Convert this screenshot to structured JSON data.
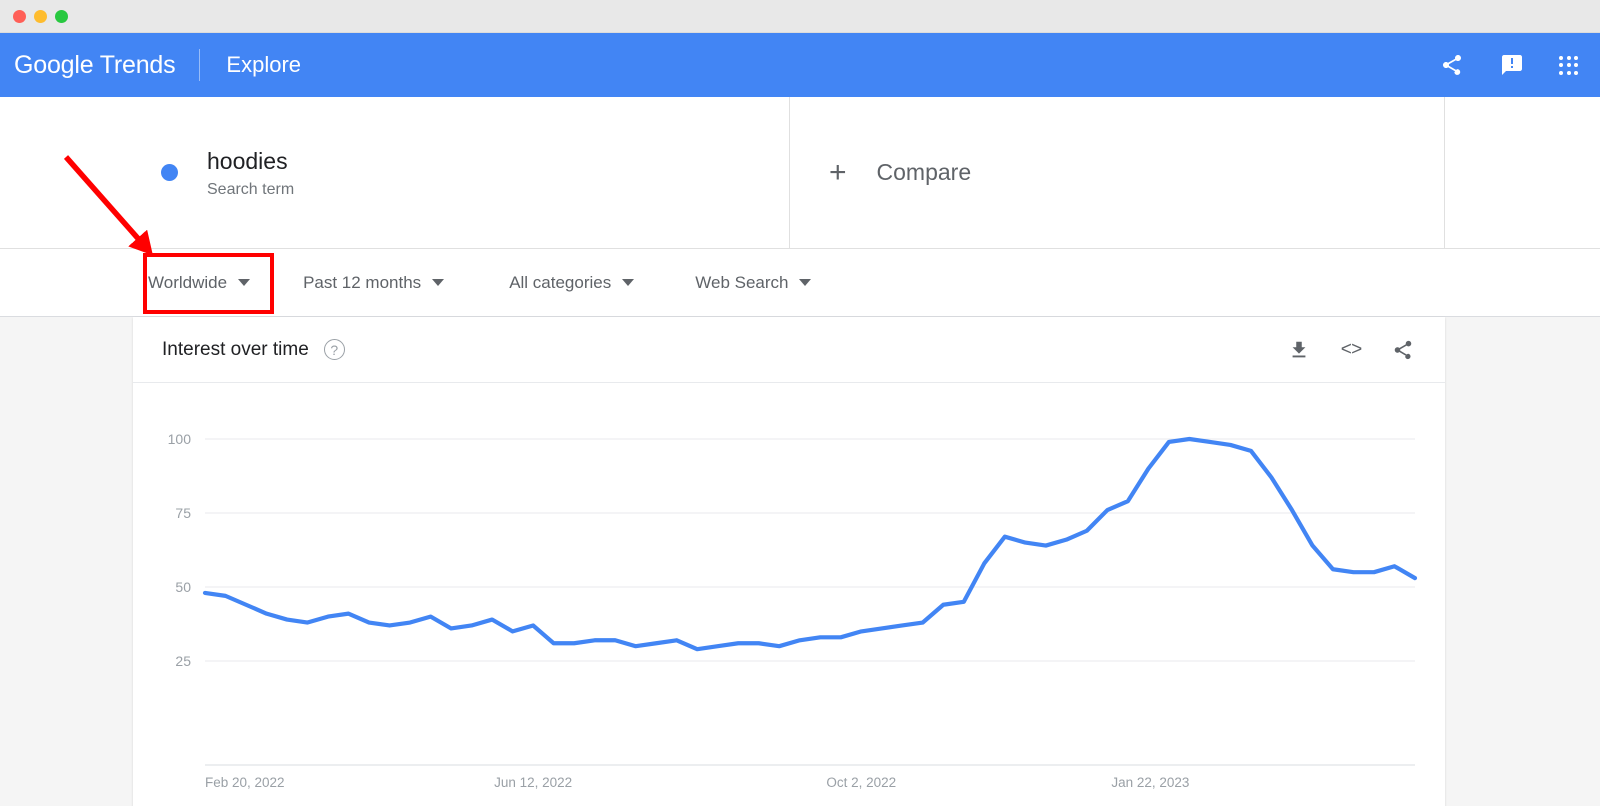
{
  "window": {
    "traffic_lights": [
      "close",
      "minimize",
      "maximize"
    ]
  },
  "header": {
    "brand_google": "Google",
    "brand_trends": "Trends",
    "nav_explore": "Explore",
    "icons": [
      "share-icon",
      "feedback-icon",
      "apps-grid-icon"
    ],
    "background_color": "#4285f4"
  },
  "search_terms": {
    "items": [
      {
        "name": "hoodies",
        "type": "Search term",
        "color": "#4285f4"
      }
    ],
    "compare_label": "Compare",
    "compare_plus": "+"
  },
  "filters": [
    {
      "name": "location",
      "value": "Worldwide",
      "highlighted": true
    },
    {
      "name": "time-range",
      "value": "Past 12 months",
      "highlighted": false
    },
    {
      "name": "category",
      "value": "All categories",
      "highlighted": false
    },
    {
      "name": "search-type",
      "value": "Web Search",
      "highlighted": false
    }
  ],
  "annotation": {
    "color": "#ff0000",
    "target": "Worldwide",
    "type": "arrow-and-box"
  },
  "card": {
    "title": "Interest over time",
    "help_glyph": "?",
    "actions": [
      {
        "name": "download-csv",
        "icon": "download-icon"
      },
      {
        "name": "embed",
        "icon": "embed-code-icon",
        "glyph": "<>"
      },
      {
        "name": "share",
        "icon": "share-icon"
      }
    ]
  },
  "chart_data": {
    "type": "line",
    "title": "Interest over time",
    "xlabel": "",
    "ylabel": "",
    "ylim": [
      0,
      100
    ],
    "yticks": [
      25,
      50,
      75,
      100
    ],
    "grid": true,
    "legend_position": "none",
    "line_color": "#4285f4",
    "x_tick_labels": [
      "Feb 20, 2022",
      "Jun 12, 2022",
      "Oct 2, 2022",
      "Jan 22, 2023"
    ],
    "x_tick_indices": [
      0,
      16,
      32,
      48
    ],
    "series": [
      {
        "name": "hoodies",
        "color": "#4285f4",
        "values": [
          48,
          47,
          44,
          41,
          39,
          38,
          40,
          41,
          38,
          37,
          38,
          40,
          36,
          37,
          39,
          35,
          37,
          31,
          31,
          32,
          32,
          30,
          31,
          32,
          29,
          30,
          31,
          31,
          30,
          32,
          33,
          33,
          35,
          36,
          37,
          38,
          44,
          45,
          58,
          67,
          65,
          64,
          66,
          69,
          76,
          79,
          90,
          99,
          100,
          99,
          98,
          96,
          87,
          76,
          64,
          56,
          55,
          55,
          57,
          53
        ]
      }
    ]
  }
}
